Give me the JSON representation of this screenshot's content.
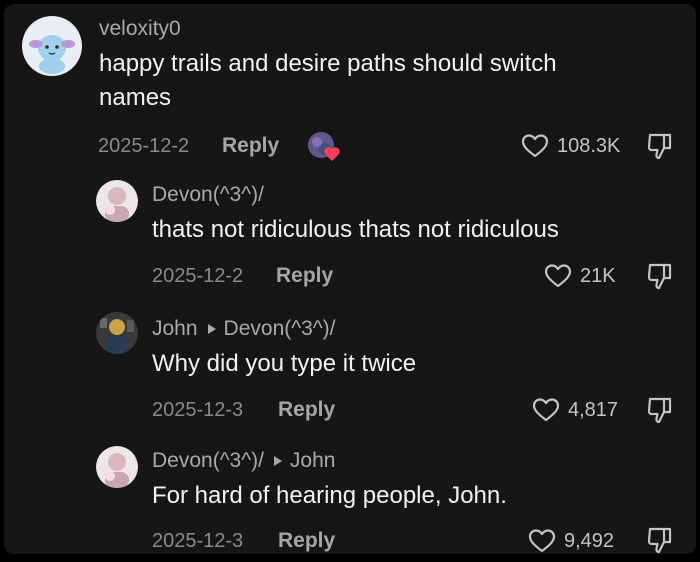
{
  "comments": [
    {
      "username": "veloxity0",
      "text": "happy trails and desire paths should switch names",
      "date": "2025-12-2",
      "reply_label": "Reply",
      "likes": "108.3K"
    },
    {
      "username": "Devon(^3^)/",
      "text": "thats not ridiculous thats not ridiculous",
      "date": "2025-12-2",
      "reply_label": "Reply",
      "likes": "21K"
    },
    {
      "username": "John",
      "reply_to": "Devon(^3^)/",
      "text": "Why did you type it twice",
      "date": "2025-12-3",
      "reply_label": "Reply",
      "likes": "4,817"
    },
    {
      "username": "Devon(^3^)/",
      "reply_to": "John",
      "text": "For hard of hearing people, John.",
      "date": "2025-12-3",
      "reply_label": "Reply",
      "likes": "9,492"
    }
  ],
  "icons": {
    "like": "heart-outline-icon",
    "dislike": "thumbs-down-icon",
    "reply_to": "triangle-right-icon",
    "creator_liked": "creator-liked-heart-icon"
  },
  "colors": {
    "background": "#161616",
    "text": "#f2f2f2",
    "secondary": "#a9a9a9",
    "creator_heart": "#ff3b5c"
  }
}
